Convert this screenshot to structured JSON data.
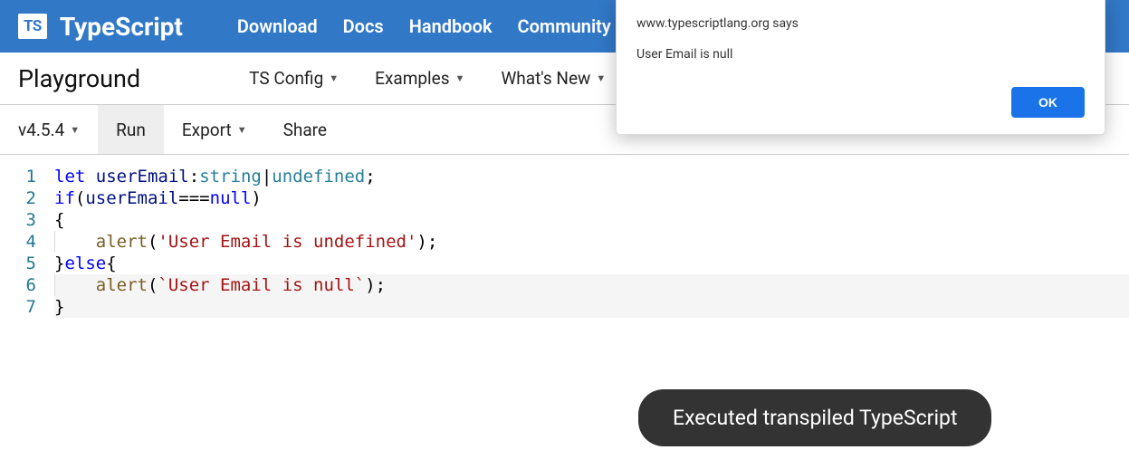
{
  "brand": {
    "logo": "TS",
    "name": "TypeScript"
  },
  "nav": {
    "download": "Download",
    "docs": "Docs",
    "handbook": "Handbook",
    "community": "Community"
  },
  "subnav": {
    "title": "Playground",
    "ts_config": "TS Config",
    "examples": "Examples",
    "whats_new": "What's New"
  },
  "toolbar": {
    "version": "v4.5.4",
    "run": "Run",
    "export": "Export",
    "share": "Share"
  },
  "editor": {
    "line_numbers": [
      "1",
      "2",
      "3",
      "4",
      "5",
      "6",
      "7"
    ],
    "tokens": {
      "let_kw": "let",
      "var_name": "userEmail",
      "type_string": "string",
      "type_undefined": "undefined",
      "if_kw": "if",
      "null_kw": "null",
      "alert_fn": "alert",
      "else_kw": "else",
      "str1": "'User Email is undefined'",
      "str2": "`User Email is null`"
    }
  },
  "dialog": {
    "origin": "www.typescriptlang.org says",
    "message": "User Email is null",
    "ok": "OK"
  },
  "toast": {
    "message": "Executed transpiled TypeScript"
  }
}
